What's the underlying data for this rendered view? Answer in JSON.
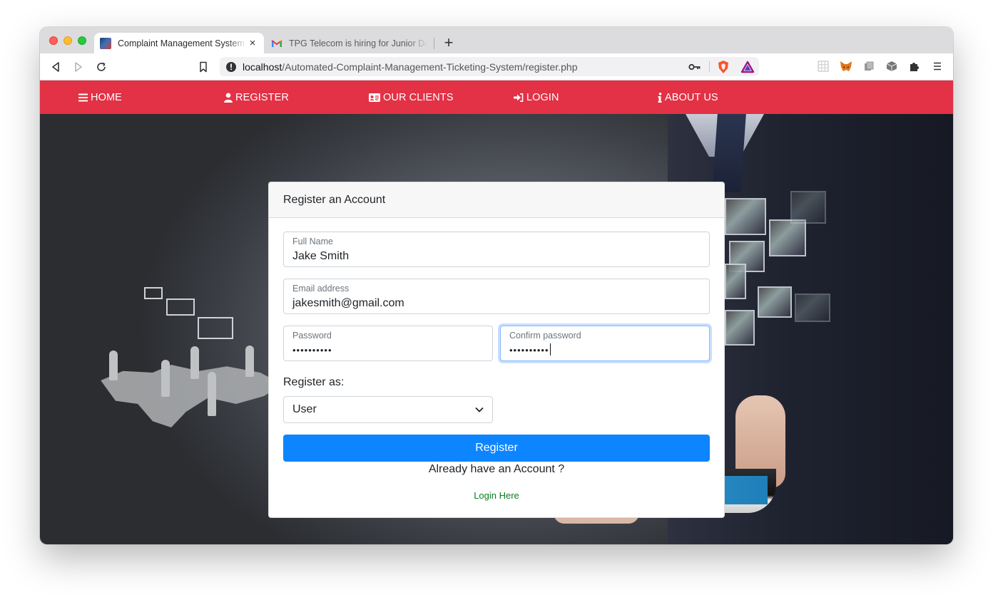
{
  "browser": {
    "tabs": [
      {
        "title": "Complaint Management System",
        "active": true,
        "favicon": "cms-favicon"
      },
      {
        "title": "TPG Telecom is hiring for Junior Dev",
        "active": false,
        "favicon": "gmail-icon"
      }
    ],
    "new_tab_label": "+",
    "close_label": "×",
    "url_host": "localhost",
    "url_path": "/Automated-Complaint-Management-Ticketing-System/register.php",
    "extensions": [
      "grid-extension-icon",
      "metamask-icon",
      "copy-extension-icon",
      "box-extension-icon",
      "puzzle-icon"
    ]
  },
  "navbar": {
    "background_color": "#e33145",
    "items": [
      {
        "label": "HOME",
        "icon": "bars-icon"
      },
      {
        "label": "REGISTER",
        "icon": "user-icon"
      },
      {
        "label": "OUR CLIENTS",
        "icon": "id-card-icon"
      },
      {
        "label": "LOGIN",
        "icon": "sign-in-icon"
      },
      {
        "label": "ABOUT US",
        "icon": "info-icon"
      }
    ]
  },
  "form": {
    "title": "Register an Account",
    "full_name": {
      "label": "Full Name",
      "value": "Jake Smith"
    },
    "email": {
      "label": "Email address",
      "value": "jakesmith@gmail.com"
    },
    "password": {
      "label": "Password",
      "value": "••••••••••"
    },
    "confirm_password": {
      "label": "Confirm password",
      "value": "••••••••••",
      "focused": true
    },
    "register_as_label": "Register as:",
    "register_as_value": "User",
    "submit_label": "Register",
    "already_text": "Already have an Account ?",
    "login_link_label": "Login Here",
    "accent_color": "#0d85ff",
    "link_color": "#0a7d1f"
  }
}
